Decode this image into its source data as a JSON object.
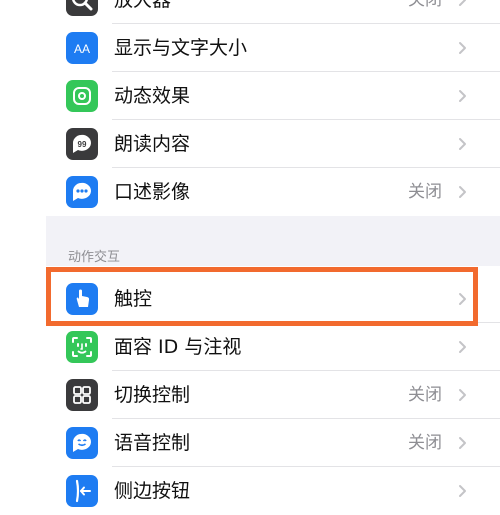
{
  "rows_top": [
    {
      "label": "放大器",
      "value": "关闭",
      "icon": "magnifier-icon"
    },
    {
      "label": "显示与文字大小",
      "value": "",
      "icon": "text-size-icon"
    },
    {
      "label": "动态效果",
      "value": "",
      "icon": "motion-icon"
    },
    {
      "label": "朗读内容",
      "value": "",
      "icon": "speech-icon"
    },
    {
      "label": "口述影像",
      "value": "关闭",
      "icon": "audio-description-icon"
    }
  ],
  "section": {
    "header": "动作交互"
  },
  "rows_bottom": [
    {
      "label": "触控",
      "value": "",
      "icon": "touch-icon"
    },
    {
      "label": "面容 ID 与注视",
      "value": "",
      "icon": "face-id-icon"
    },
    {
      "label": "切换控制",
      "value": "关闭",
      "icon": "switch-control-icon"
    },
    {
      "label": "语音控制",
      "value": "关闭",
      "icon": "voice-control-icon"
    },
    {
      "label": "侧边按钮",
      "value": "",
      "icon": "side-button-icon"
    }
  ],
  "colors": {
    "highlight": "#f26a2e",
    "blue": "#1e7cf2",
    "green": "#34c759",
    "dark": "#3a3a3c"
  }
}
